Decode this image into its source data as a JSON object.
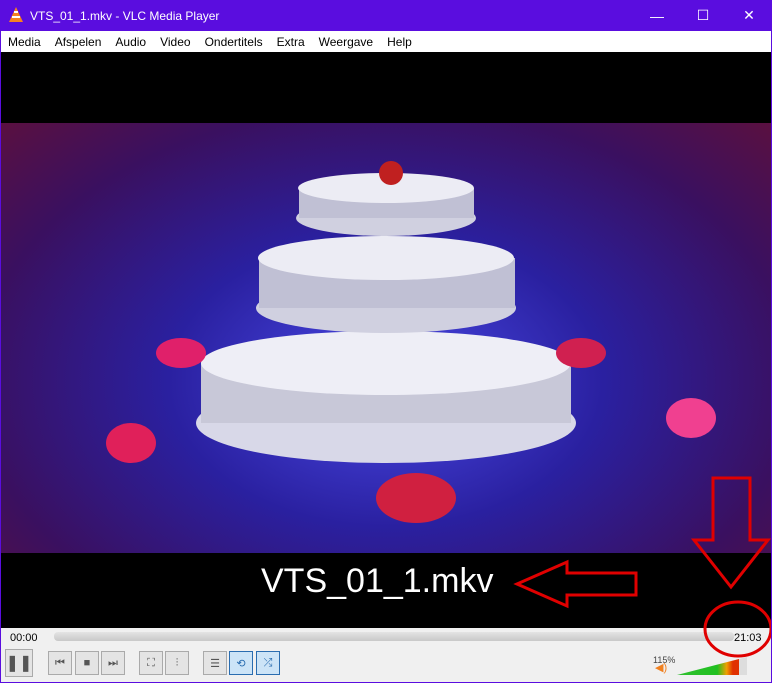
{
  "window": {
    "title": "VTS_01_1.mkv - VLC Media Player",
    "minimize": "—",
    "maximize": "☐",
    "close": "✕"
  },
  "menu": [
    "Media",
    "Afspelen",
    "Audio",
    "Video",
    "Ondertitels",
    "Extra",
    "Weergave",
    "Help"
  ],
  "video": {
    "subtitle": "VTS_01_1.mkv"
  },
  "controls": {
    "elapsed": "00:00",
    "total": "21:03",
    "progress": 0,
    "volume_label": "115%",
    "volume": 1.15,
    "buttons": {
      "pause": "❚❚",
      "prev": "⏮",
      "stop": "■",
      "next": "⏭",
      "fullscreen": "⛶",
      "extended": "⫶",
      "playlist": "☰",
      "loop": "⟲",
      "random": "⤮",
      "speaker": "🔊"
    }
  },
  "colors": {
    "titlebar": "#5a0ddf",
    "annotation": "#e00000"
  }
}
